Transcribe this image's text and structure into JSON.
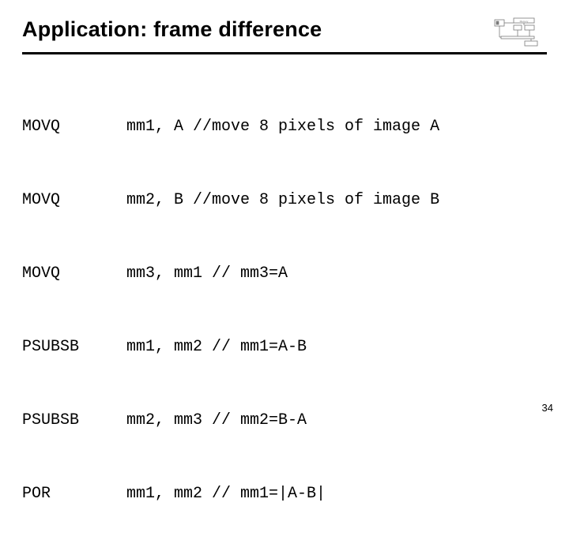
{
  "title": "Application: frame difference",
  "page_number": "34",
  "code_rows": [
    {
      "mnemonic": "MOVQ",
      "operands": "mm1, A //move 8 pixels of image A"
    },
    {
      "mnemonic": "MOVQ",
      "operands": "mm2, B //move 8 pixels of image B"
    },
    {
      "mnemonic": "MOVQ",
      "operands": "mm3, mm1 // mm3=A"
    },
    {
      "mnemonic": "PSUBSB",
      "operands": "mm1, mm2 // mm1=A-B"
    },
    {
      "mnemonic": "PSUBSB",
      "operands": "mm2, mm3 // mm2=B-A"
    },
    {
      "mnemonic": "POR",
      "operands": "mm1, mm2 // mm1=|A-B|"
    }
  ]
}
